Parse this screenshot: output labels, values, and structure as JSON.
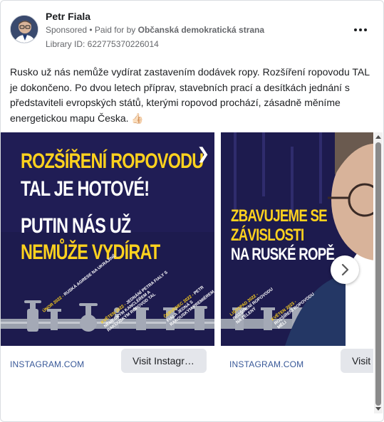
{
  "advertiser": {
    "name": "Petr Fiala",
    "sponsored": "Sponsored",
    "paid_for_by_prefix": " • Paid for by ",
    "paid_for_by": "Občanská demokratická strana",
    "library_id": "Library ID: 622775370226014"
  },
  "post": {
    "text": "Rusko už nás nemůže vydírat zastavením dodávek ropy. Rozšíření ropovodu TAL je dokončeno. Po dvou letech příprav, stavebních prací a desítkách jednání s představiteli evropských států, kterými ropovod prochází, zásadně měníme energetickou mapu Česka. 👍🏻"
  },
  "cards": [
    {
      "headline": {
        "line1": "ROZŠÍŘENÍ ROPOVODU",
        "line2": "TAL JE HOTOVÉ!",
        "line3": "PUTIN NÁS UŽ",
        "line4": "NEMŮŽE VYDÍRAT"
      },
      "timeline": [
        {
          "date": "ÚNOR 2022 -",
          "text": "RUSKÁ AGRESE NA UKRAJINĚ"
        },
        {
          "date": "KVĚTEN 2022 -",
          "text": "JEDNÁNÍ PETRA FIALY S NĚMECKÝM KANCLÉŘEM A RAKOUSKÝM",
          "text2": "ROPOVOD TAL"
        },
        {
          "date": "ČERVENEC 2022 -",
          "text": "PETR FIALA JEDNÁ S RAKOUSKÝM PREMIÉREM"
        }
      ],
      "domain": "INSTAGRAM.COM",
      "button": "Visit Instagr…"
    },
    {
      "headline": {
        "line1": "ZBAVUJEME SE",
        "line2": "ZÁVISLOSTI",
        "line3": "NA RUSKÉ ROPĚ"
      },
      "timeline": [
        {
          "date": "LISTOPAD 2022 -",
          "text": "ROZŠÍŘENÍ ROPOVODU NA ZELENÝ"
        },
        {
          "date": "KVĚTEN 2023 -",
          "text": "ROZŠÍŘENÍ ROPOVODU MĚLI"
        }
      ],
      "domain": "INSTAGRAM.COM",
      "button": "Visit"
    }
  ],
  "colors": {
    "ad_background": "#1d1b4e",
    "ad_yellow": "#ffd21e",
    "link_blue": "#385898",
    "button_grey": "#e4e6eb"
  },
  "icons": {
    "more": "more-options-icon",
    "next": "chevron-right-icon"
  }
}
